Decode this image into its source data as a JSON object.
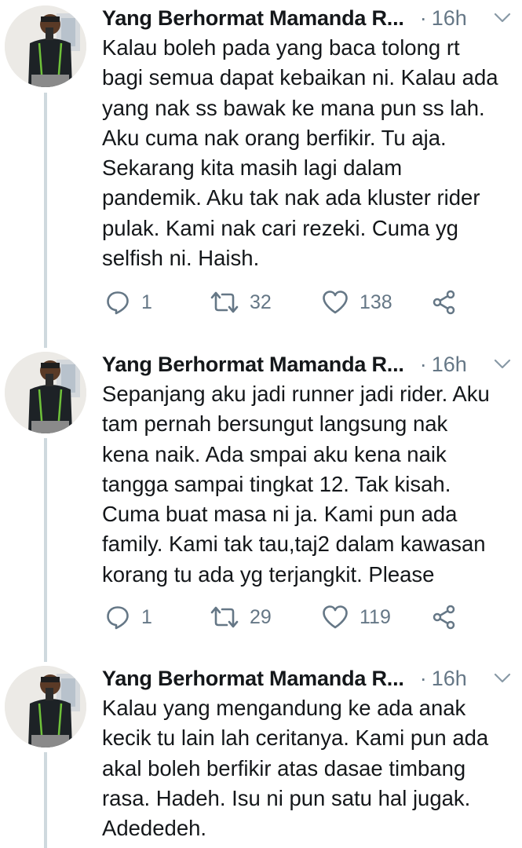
{
  "tweets": [
    {
      "name": "Yang Berhormat Mamanda R...",
      "separator": "·",
      "time": "16h",
      "text": "Kalau boleh pada yang baca tolong rt\nbagi semua dapat kebaikan ni. Kalau ada\nyang nak ss bawak ke mana pun ss lah.\nAku cuma nak orang berfikir. Tu aja.\nSekarang kita masih lagi dalam\npandemik. Aku tak nak ada kluster rider\npulak. Kami nak cari rezeki. Cuma yg\nselfish ni. Haish.",
      "replies": "1",
      "retweets": "32",
      "likes": "138"
    },
    {
      "name": "Yang Berhormat Mamanda R...",
      "separator": "·",
      "time": "16h",
      "text": "Sepanjang aku jadi runner jadi rider. Aku\ntam pernah bersungut langsung nak\nkena naik. Ada smpai aku kena naik\ntangga sampai tingkat 12. Tak kisah.\nCuma buat masa ni ja. Kami pun ada\nfamily. Kami tak tau,taj2 dalam kawasan\nkorang tu ada yg terjangkit. Please",
      "replies": "1",
      "retweets": "29",
      "likes": "119"
    },
    {
      "name": "Yang Berhormat Mamanda R...",
      "separator": "·",
      "time": "16h",
      "text": "Kalau yang mengandung ke ada anak\nkecik tu lain lah ceritanya. Kami pun ada\nakal boleh berfikir atas dasae timbang\nrasa. Hadeh. Isu ni pun satu hal jugak.\nAdededeh."
    }
  ],
  "icons": {
    "reply": "reply-icon",
    "retweet": "retweet-icon",
    "like": "heart-icon",
    "share": "share-icon",
    "menu": "chevron-down-icon"
  },
  "colors": {
    "text": "#14171a",
    "secondary": "#657786",
    "thread_line": "#cfd9de"
  }
}
